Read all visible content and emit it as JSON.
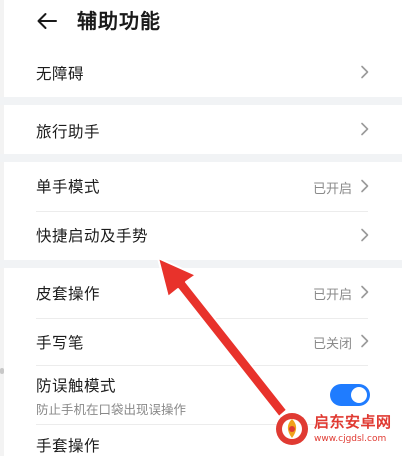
{
  "header": {
    "title": "辅助功能",
    "back_icon": "arrow-left-icon"
  },
  "items": [
    {
      "label": "无障碍"
    },
    {
      "label": "旅行助手"
    },
    {
      "label": "单手模式",
      "value": "已开启"
    },
    {
      "label": "快捷启动及手势"
    },
    {
      "label": "皮套操作",
      "value": "已开启"
    },
    {
      "label": "手写笔",
      "value": "已关闭"
    },
    {
      "label": "防误触模式",
      "sublabel": "防止手机在口袋出现误操作",
      "toggle_on": true
    },
    {
      "label": "手套操作"
    }
  ],
  "annotation": {
    "color": "#e8322b",
    "icon": "red-arrow-icon"
  },
  "watermark": {
    "name": "启东安卓网",
    "url": "www.cjgdsl.com",
    "color": "#e03a32"
  },
  "colors": {
    "accent": "#1f7cff",
    "section_gap": "#f1f3f5",
    "secondary_text": "#8a8a8a"
  }
}
